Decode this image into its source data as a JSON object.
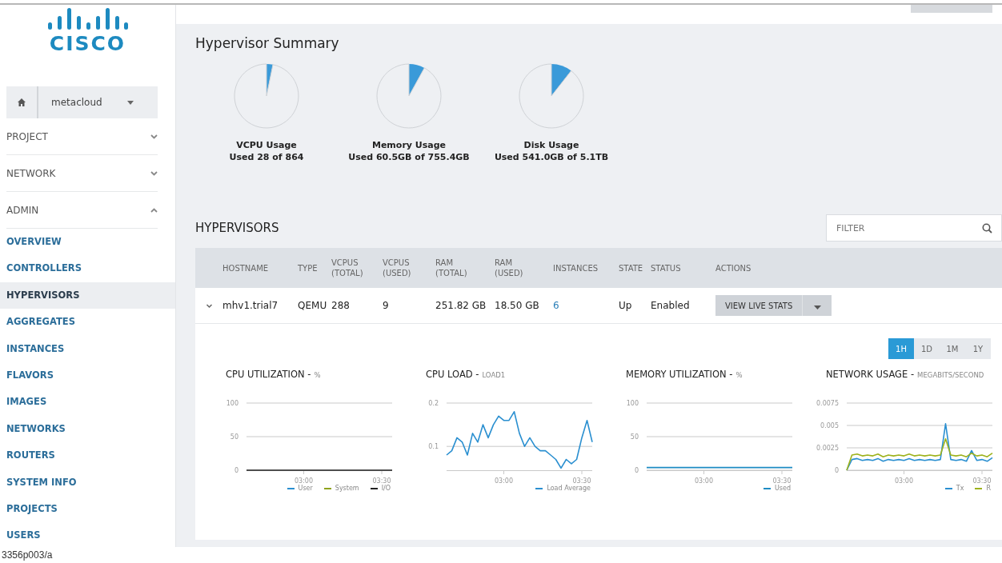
{
  "logo": {
    "text": "CISCO"
  },
  "sidebar": {
    "project": "metacloud",
    "sections": [
      {
        "label": "PROJECT",
        "expanded": false
      },
      {
        "label": "NETWORK",
        "expanded": false
      },
      {
        "label": "ADMIN",
        "expanded": true,
        "items": [
          {
            "label": "OVERVIEW",
            "selected": false
          },
          {
            "label": "CONTROLLERS",
            "selected": false
          },
          {
            "label": "HYPERVISORS",
            "selected": true
          },
          {
            "label": "AGGREGATES",
            "selected": false
          },
          {
            "label": "INSTANCES",
            "selected": false
          },
          {
            "label": "FLAVORS",
            "selected": false
          },
          {
            "label": "IMAGES",
            "selected": false
          },
          {
            "label": "NETWORKS",
            "selected": false
          },
          {
            "label": "ROUTERS",
            "selected": false
          },
          {
            "label": "SYSTEM INFO",
            "selected": false
          },
          {
            "label": "PROJECTS",
            "selected": false
          },
          {
            "label": "USERS",
            "selected": false
          }
        ]
      }
    ]
  },
  "summary": {
    "title": "Hypervisor Summary",
    "gauges": [
      {
        "title": "VCPU Usage",
        "detail": "Used 28 of 864",
        "chart_data": {
          "type": "pie",
          "values": [
            3.2,
            96.8
          ]
        }
      },
      {
        "title": "Memory Usage",
        "detail": "Used 60.5GB of 755.4GB",
        "chart_data": {
          "type": "pie",
          "values": [
            8,
            92
          ]
        }
      },
      {
        "title": "Disk Usage",
        "detail": "Used 541.0GB of 5.1TB",
        "chart_data": {
          "type": "pie",
          "values": [
            10.6,
            89.4
          ]
        }
      }
    ]
  },
  "hypervisors": {
    "title": "HYPERVISORS",
    "filter": {
      "placeholder": "FILTER"
    },
    "columns": [
      "HOSTNAME",
      "TYPE",
      "VCPUS (TOTAL)",
      "VCPUS (USED)",
      "RAM (TOTAL)",
      "RAM (USED)",
      "INSTANCES",
      "STATE",
      "STATUS",
      "ACTIONS"
    ],
    "rows": [
      {
        "expanded": true,
        "cells": [
          {
            "kind": "text",
            "text": "mhv1.trial7"
          },
          {
            "kind": "text",
            "text": "QEMU"
          },
          {
            "kind": "text",
            "text": "288"
          },
          {
            "kind": "text",
            "text": "9"
          },
          {
            "kind": "text",
            "text": "251.82 GB"
          },
          {
            "kind": "text",
            "text": "18.50 GB"
          },
          {
            "kind": "link",
            "text": "6"
          },
          {
            "kind": "text",
            "text": "Up"
          },
          {
            "kind": "text",
            "text": "Enabled"
          },
          {
            "kind": "action",
            "text": "VIEW LIVE STATS"
          }
        ]
      }
    ],
    "time_ranges": [
      {
        "label": "1H",
        "selected": true
      },
      {
        "label": "1D",
        "selected": false
      },
      {
        "label": "1M",
        "selected": false
      },
      {
        "label": "1Y",
        "selected": false
      }
    ],
    "charts": [
      {
        "title": "CPU UTILIZATION -",
        "unit": "%",
        "chart_data": {
          "type": "line",
          "categories": [
            null,
            null,
            null,
            null,
            null,
            null,
            null,
            null,
            null,
            null,
            null,
            "03:00",
            null,
            null,
            null,
            null,
            null,
            null,
            null,
            null,
            null,
            null,
            null,
            null,
            null,
            null,
            "03:30",
            null,
            null
          ],
          "ylim": [
            0,
            100
          ],
          "yticks": [
            0,
            50,
            100
          ],
          "legend": "lower right",
          "series": [
            {
              "name": "User",
              "color": "#2a8fd0",
              "values": [
                null,
                null,
                null,
                null,
                null,
                null,
                null,
                null,
                null,
                null,
                null,
                null,
                null,
                null,
                null,
                null,
                null,
                null,
                null,
                null,
                null,
                null,
                null,
                null,
                null,
                null,
                null,
                null,
                null
              ]
            },
            {
              "name": "System",
              "color": "#8fa31c",
              "values": [
                null,
                null,
                null,
                null,
                null,
                null,
                null,
                null,
                null,
                null,
                null,
                null,
                null,
                null,
                null,
                null,
                null,
                null,
                null,
                null,
                null,
                null,
                null,
                null,
                null,
                null,
                null,
                null,
                null
              ]
            },
            {
              "name": "I/O",
              "color": "#222222",
              "values": [
                0,
                0,
                0,
                0,
                0,
                0,
                0,
                0,
                0,
                0,
                0,
                0,
                0,
                0,
                0,
                0,
                0,
                0,
                0,
                0,
                0,
                0,
                0,
                0,
                0,
                0,
                0,
                0,
                0
              ]
            }
          ]
        }
      },
      {
        "title": "CPU LOAD -",
        "unit": "LOAD1",
        "chart_data": {
          "type": "line",
          "categories": [
            null,
            null,
            null,
            null,
            null,
            null,
            null,
            null,
            null,
            null,
            null,
            "03:00",
            null,
            null,
            null,
            null,
            null,
            null,
            null,
            null,
            null,
            null,
            null,
            null,
            null,
            null,
            "03:30",
            null,
            null
          ],
          "ylim": [
            0.045,
            0.2
          ],
          "yticks": [
            0.1,
            0.2
          ],
          "legend": "lower right",
          "series": [
            {
              "name": "Load Average",
              "color": "#2a8fd0",
              "values": [
                0.08,
                0.09,
                0.12,
                0.11,
                0.08,
                0.13,
                0.11,
                0.15,
                0.12,
                0.15,
                0.17,
                0.16,
                0.16,
                0.18,
                0.13,
                0.1,
                0.12,
                0.1,
                0.09,
                0.09,
                0.08,
                0.07,
                0.05,
                0.07,
                0.06,
                0.07,
                0.12,
                0.16,
                0.11
              ]
            }
          ]
        }
      },
      {
        "title": "MEMORY UTILIZATION -",
        "unit": "%",
        "chart_data": {
          "type": "line",
          "categories": [
            null,
            null,
            null,
            null,
            null,
            null,
            null,
            null,
            null,
            null,
            null,
            "03:00",
            null,
            null,
            null,
            null,
            null,
            null,
            null,
            null,
            null,
            null,
            null,
            null,
            null,
            null,
            "03:30",
            null,
            null
          ],
          "ylim": [
            0,
            100
          ],
          "yticks": [
            0,
            50,
            100
          ],
          "legend": "lower right",
          "series": [
            {
              "name": "Used",
              "color": "#1e8bc3",
              "values": [
                4,
                4,
                4,
                4,
                4,
                4,
                4,
                4,
                4,
                4,
                4,
                4,
                4,
                4,
                4,
                4,
                4,
                4,
                4,
                4,
                4,
                4,
                4,
                4,
                4,
                4,
                4,
                4,
                4
              ]
            }
          ]
        }
      },
      {
        "title": "NETWORK USAGE -",
        "unit": "MEGABITS/SECOND",
        "chart_data": {
          "type": "line",
          "categories": [
            null,
            null,
            null,
            null,
            null,
            null,
            null,
            null,
            null,
            null,
            null,
            "03:00",
            null,
            null,
            null,
            null,
            null,
            null,
            null,
            null,
            null,
            null,
            null,
            null,
            null,
            null,
            "03:30",
            null,
            null
          ],
          "ylim": [
            0,
            0.0075
          ],
          "yticks": [
            0,
            0.0025,
            0.005,
            0.0075
          ],
          "legend": "lower right",
          "series": [
            {
              "name": "Tx",
              "color": "#2a8fd0",
              "values": [
                0,
                0.0012,
                0.0013,
                0.0011,
                0.0012,
                0.0011,
                0.0013,
                0.001,
                0.0012,
                0.0011,
                0.0012,
                0.0011,
                0.0013,
                0.0011,
                0.0012,
                0.0011,
                0.0012,
                0.0011,
                0.0012,
                0.0052,
                0.0012,
                0.0011,
                0.0012,
                0.001,
                0.0022,
                0.0011,
                0.0012,
                0.001,
                0.0014
              ]
            },
            {
              "name": "R",
              "color": "#9db21c",
              "values": [
                0,
                0.0017,
                0.0018,
                0.0016,
                0.0017,
                0.0016,
                0.0018,
                0.0015,
                0.0017,
                0.0016,
                0.0017,
                0.0016,
                0.0018,
                0.0016,
                0.0017,
                0.0016,
                0.0017,
                0.0016,
                0.0017,
                0.0035,
                0.0017,
                0.0016,
                0.0017,
                0.0015,
                0.0019,
                0.0016,
                0.0017,
                0.0015,
                0.0019
              ]
            }
          ]
        }
      }
    ]
  },
  "caption": "3356p003/a"
}
